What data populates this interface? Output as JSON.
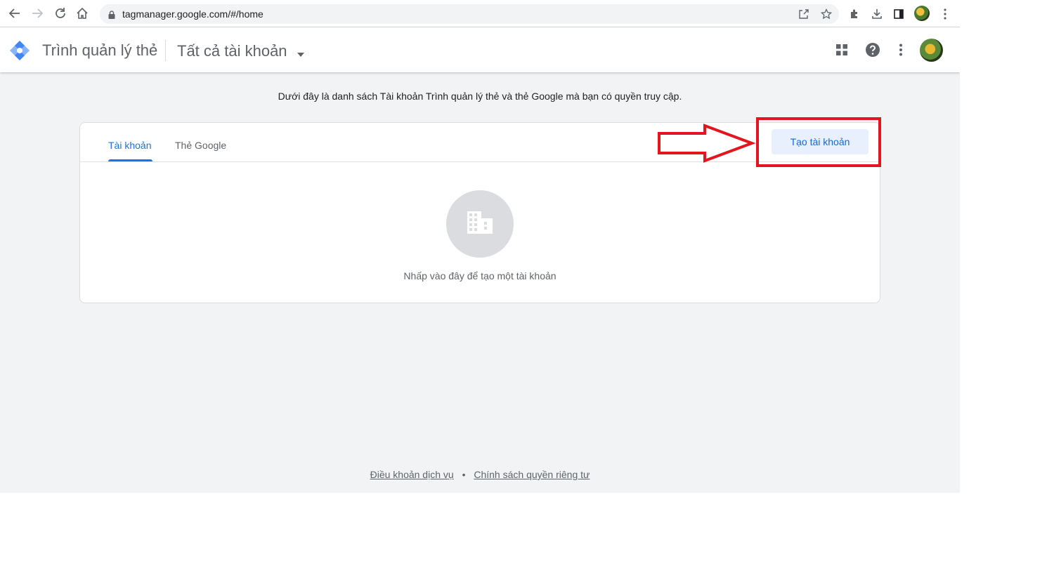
{
  "browser": {
    "url": "tagmanager.google.com/#/home"
  },
  "header": {
    "app_title": "Trình quản lý thẻ",
    "account_selector": "Tất cả tài khoản"
  },
  "main": {
    "intro_text": "Dưới đây là danh sách Tài khoản Trình quản lý thẻ và thẻ Google mà bạn có quyền truy cập.",
    "tabs": [
      {
        "label": "Tài khoản",
        "active": true
      },
      {
        "label": "Thẻ Google",
        "active": false
      }
    ],
    "create_button": "Tạo tài khoản",
    "empty_state_text": "Nhấp vào đây để tạo một tài khoản"
  },
  "footer": {
    "terms": "Điều khoản dịch vụ",
    "separator": "•",
    "privacy": "Chính sách quyền riêng tư"
  },
  "icons": {
    "back": "back-arrow-icon",
    "forward": "forward-arrow-icon",
    "reload": "reload-icon",
    "home": "home-icon",
    "lock": "lock-icon",
    "share": "share-icon",
    "bookmark": "star-icon",
    "extensions": "puzzle-icon",
    "download": "download-icon",
    "side_panel": "side-panel-icon",
    "apps": "apps-grid-icon",
    "help": "help-icon",
    "more": "more-vert-icon",
    "building": "building-icon"
  },
  "colors": {
    "accent": "#1a73e8",
    "button_bg": "#e8f0fe",
    "annotation": "#e3161f",
    "page_bg": "#f1f3f4"
  }
}
